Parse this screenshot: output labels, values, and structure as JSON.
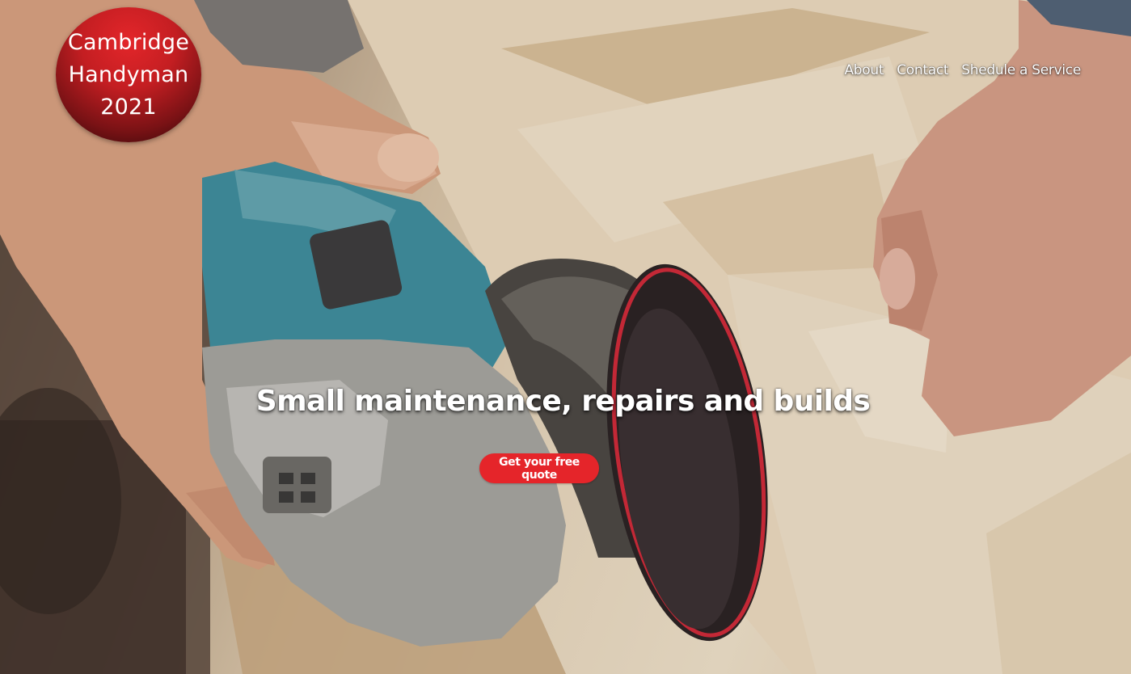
{
  "logo": {
    "line1": "Cambridge",
    "line2": "Handyman",
    "line3": "2021",
    "color": "#c41e22"
  },
  "nav": {
    "items": [
      {
        "label": "About"
      },
      {
        "label": "Contact"
      },
      {
        "label": "Shedule a Service"
      }
    ]
  },
  "hero": {
    "headline": "Small maintenance, repairs and builds",
    "cta_label": "Get your free quote",
    "cta_color": "#e5252a",
    "background_image": "angle-grinder-sanding-wood"
  }
}
